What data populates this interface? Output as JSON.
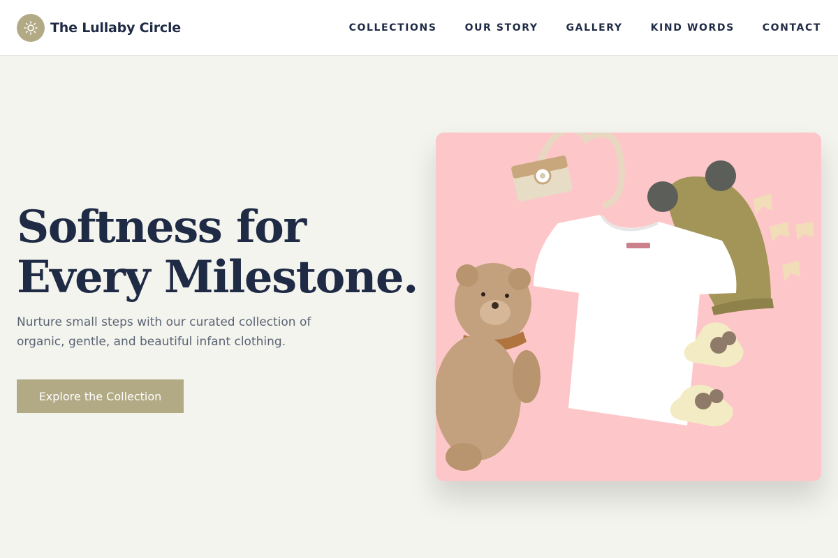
{
  "brand": {
    "name": "The Lullaby Circle",
    "logo_icon": "sun-icon"
  },
  "nav": {
    "items": [
      "COLLECTIONS",
      "OUR STORY",
      "GALLERY",
      "KIND WORDS",
      "CONTACT"
    ]
  },
  "hero": {
    "headline_line1": "Softness for",
    "headline_line2": "Every Milestone.",
    "subtitle": "Nurture small steps with our curated collection of organic, gentle, and beautiful infant clothing.",
    "cta_label": "Explore the Collection",
    "image_alt": "White baby t-shirt with teddy bear, knit hat, socks and wooden toy camera on pink background"
  },
  "colors": {
    "accent": "#b1aa85",
    "text_dark": "#1f2a44",
    "text_muted": "#5a6473",
    "background": "#f4f4ef",
    "image_background": "#fdc7c9"
  }
}
